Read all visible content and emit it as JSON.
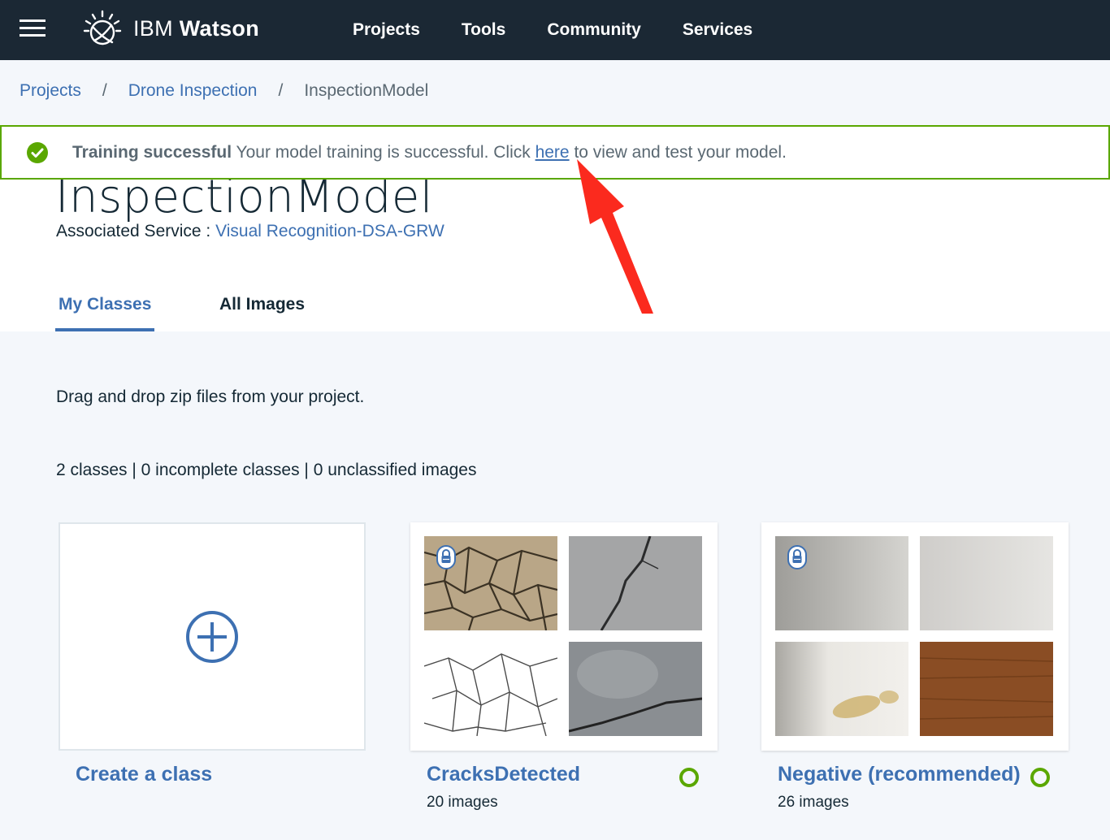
{
  "nav": {
    "brand_prefix": "IBM",
    "brand_name": "Watson",
    "links": [
      "Projects",
      "Tools",
      "Community",
      "Services"
    ]
  },
  "breadcrumb": {
    "items": [
      "Projects",
      "Drone Inspection"
    ],
    "current": "InspectionModel",
    "separator": "/"
  },
  "notification": {
    "title": "Training successful",
    "message_before": " Your model training is successful. Click ",
    "link": "here",
    "message_after": " to view and test your model.",
    "status_color": "#5aa700"
  },
  "model": {
    "title": "InspectionModel",
    "service_label": "Associated Service : ",
    "service_name": "Visual Recognition-DSA-GRW"
  },
  "tabs": [
    {
      "label": "My Classes",
      "active": true
    },
    {
      "label": "All Images",
      "active": false
    }
  ],
  "instructions": "Drag and drop zip files from your project.",
  "summary": "2 classes | 0 incomplete classes | 0 unclassified images",
  "create_card": {
    "label": "Create a class"
  },
  "classes": [
    {
      "name": "CracksDetected",
      "count": "20 images",
      "status": "complete",
      "locked": true
    },
    {
      "name": "Negative (recommended)",
      "count": "26 images",
      "status": "complete",
      "locked": true
    }
  ],
  "colors": {
    "accent": "#3d70b2",
    "success": "#5aa700",
    "nav_bg": "#1b2834"
  },
  "icons": [
    "menu-icon",
    "watson-logo-icon",
    "check-circle-icon",
    "add-circle-icon",
    "lock-icon",
    "annotation-arrow"
  ]
}
